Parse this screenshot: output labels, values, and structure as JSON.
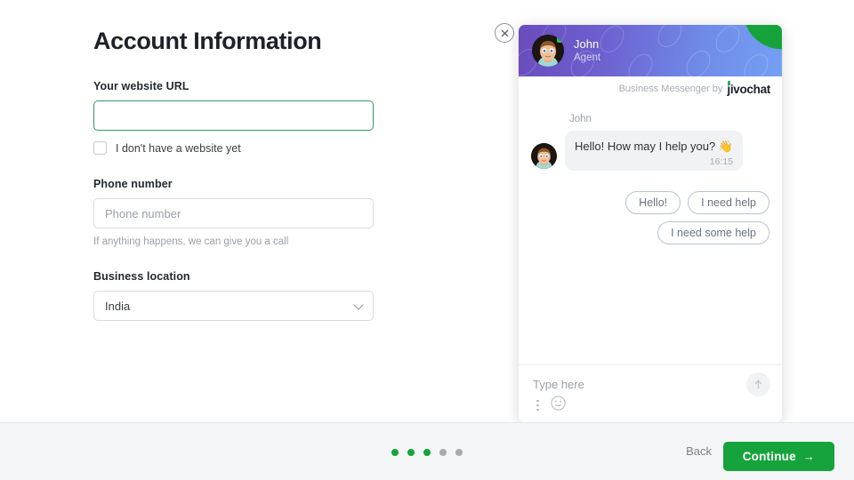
{
  "form": {
    "title": "Account Information",
    "website": {
      "label": "Your website URL",
      "value": "",
      "placeholder": ""
    },
    "no_website": {
      "label": "I don't have a website yet",
      "checked": false
    },
    "phone": {
      "label": "Phone number",
      "value": "",
      "placeholder": "Phone number",
      "hint": "If anything happens, we can give you a call"
    },
    "location": {
      "label": "Business location",
      "value": "India",
      "chevron_icon": "chevron-down-icon"
    }
  },
  "chat_widget": {
    "close_icon": "close-icon",
    "header": {
      "agent_name": "John",
      "agent_role": "Agent",
      "avatar_icon": "agent-avatar",
      "online_status_icon": "online-dot-icon",
      "gradient_from": "#6a4bbc",
      "gradient_to": "#74a0f4",
      "corner_badge_color": "#16a33c"
    },
    "branding": {
      "text": "Business Messenger by",
      "logo": "jivochat"
    },
    "conversation": {
      "sender": "John",
      "message": "Hello! How may I help you? 👋",
      "time": "16:15"
    },
    "quick_replies": [
      "Hello!",
      "I need help",
      "I need some help"
    ],
    "composer": {
      "placeholder": "Type here",
      "value": "",
      "send_icon": "send-arrow-up-icon",
      "menu_icon": "more-vertical-icon",
      "emoji_icon": "emoji-smiley-icon"
    }
  },
  "bottom_bar": {
    "progress": {
      "total": 5,
      "completed": 3,
      "active_color": "#16a33c",
      "inactive_color": "#a8adb2"
    },
    "back_label": "Back",
    "continue_label": "Continue",
    "continue_arrow": "→",
    "continue_color": "#16a33c"
  }
}
